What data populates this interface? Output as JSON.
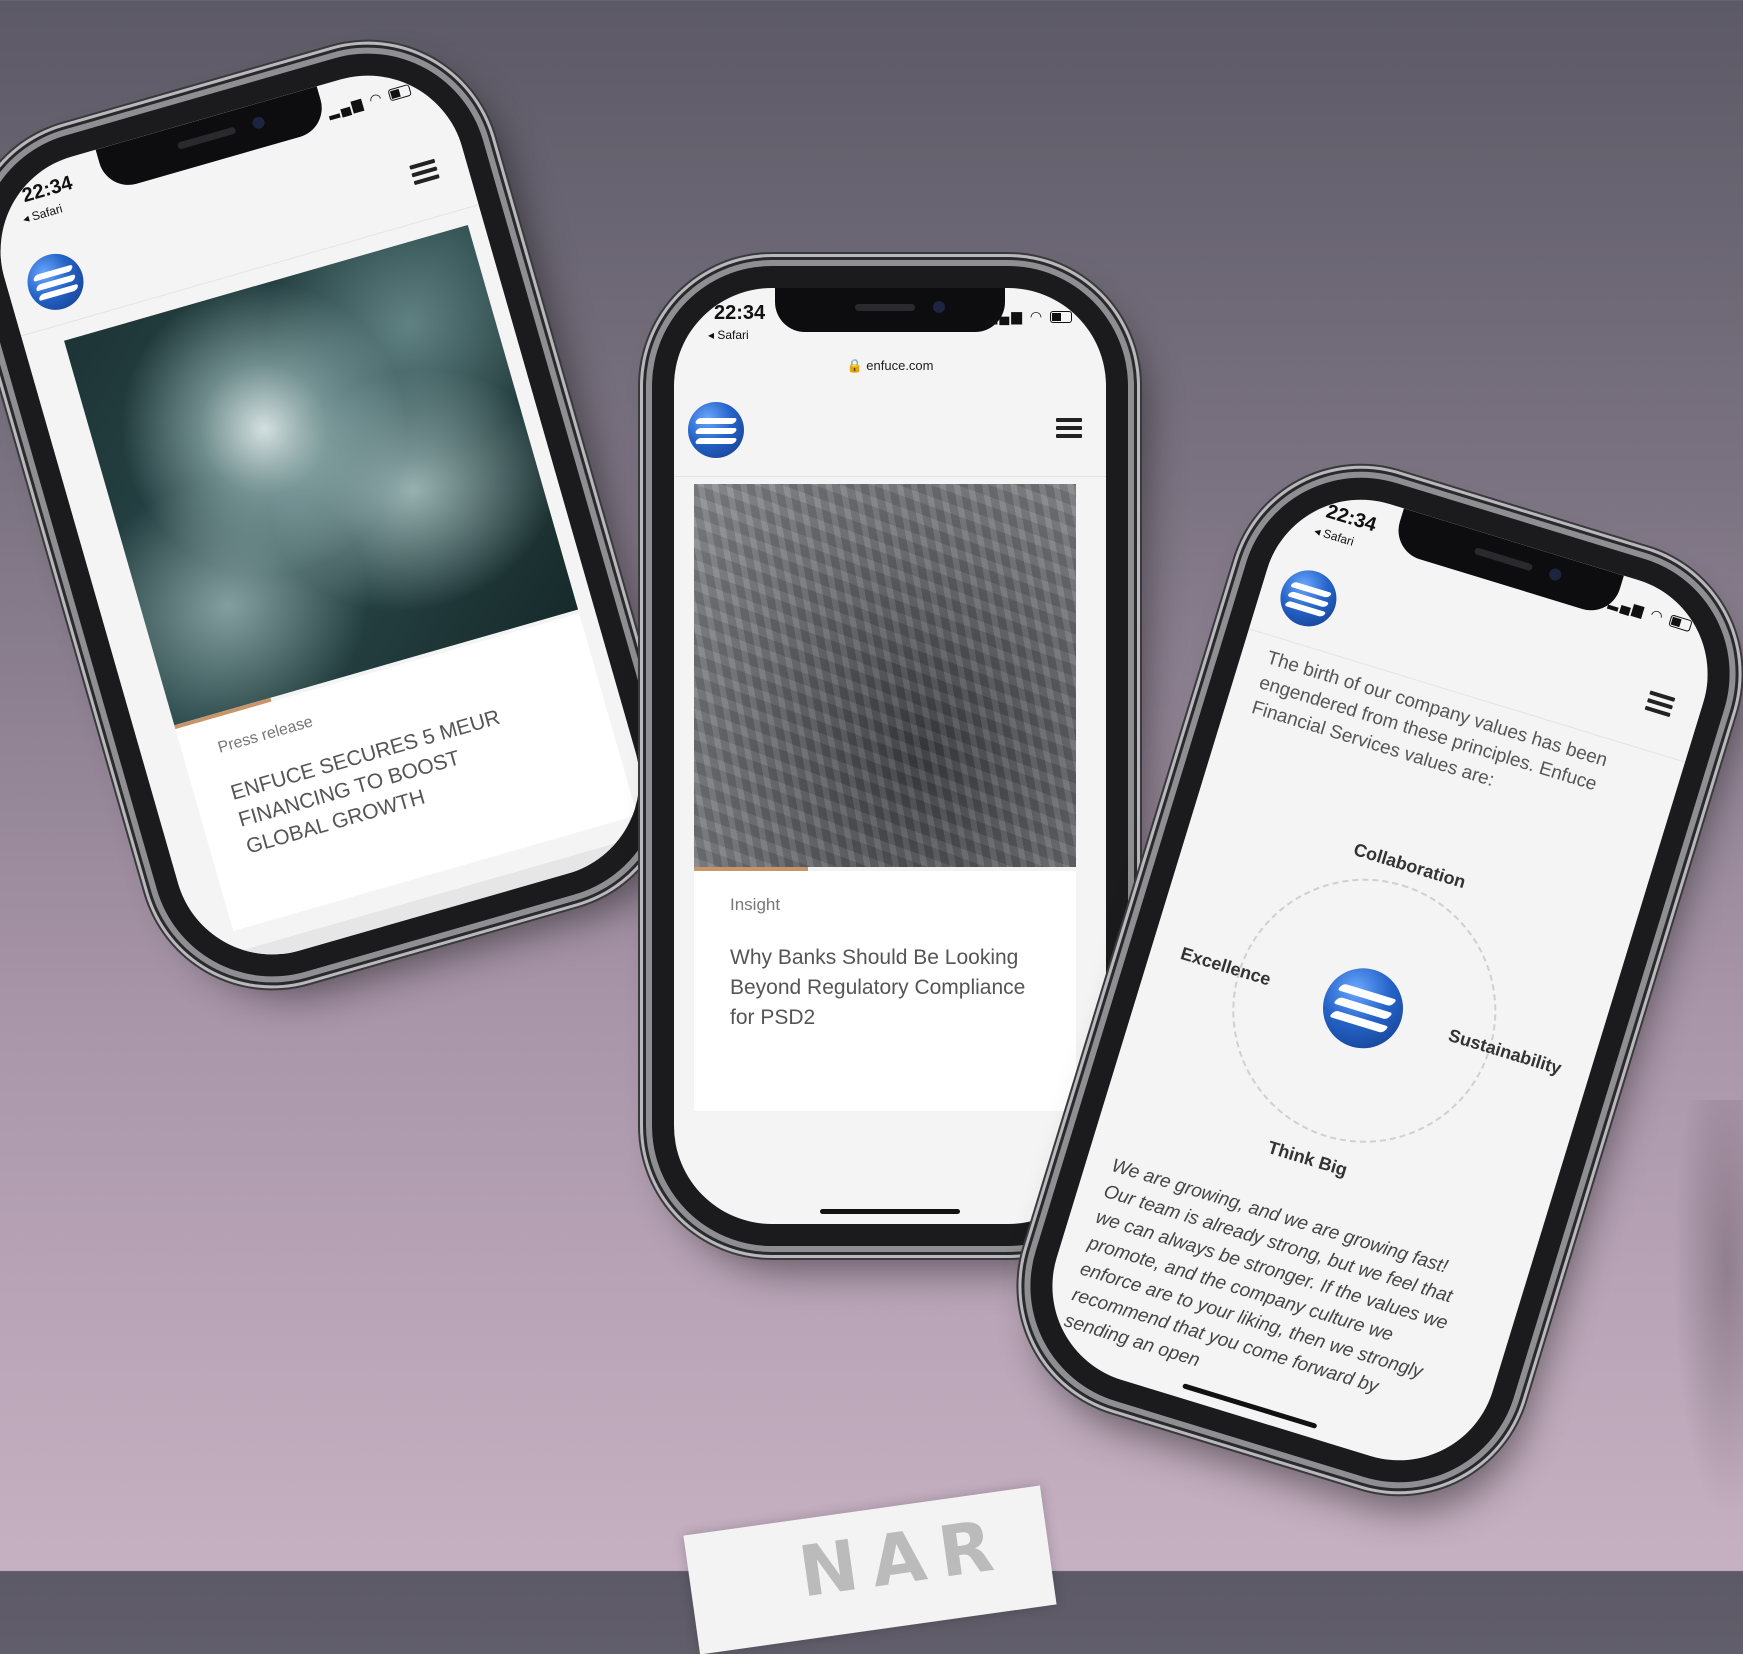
{
  "phones": [
    {
      "status": {
        "time": "22:34",
        "back": "◂ Safari"
      },
      "card": {
        "category": "Press release",
        "title": "ENFUCE SECURES 5 MEUR FINANCING TO BOOST GLOBAL GROWTH"
      }
    },
    {
      "status": {
        "time": "22:34",
        "back": "◂ Safari"
      },
      "url": "🔒 enfuce.com",
      "card": {
        "category": "Insight",
        "title": "Why Banks Should Be Looking Beyond Regulatory Compliance for PSD2"
      }
    },
    {
      "status": {
        "time": "22:34",
        "back": "◂ Safari"
      },
      "intro": "The birth of our company values has been engendered from these principles. Enfuce Financial Services values are:",
      "values": {
        "top": "Collaboration",
        "left": "Excellence",
        "right": "Sustainability",
        "bottom": "Think Big"
      },
      "body": "We are growing, and we are growing fast! Our team is already strong, but we feel that we can always be stronger. If the values we promote, and the company culture we enforce are to your liking, then we strongly recommend that you come forward by sending an open"
    }
  ],
  "icons": {
    "signal": "signal-icon",
    "wifi": "wifi-icon",
    "battery": "battery-icon",
    "menu": "hamburger-menu-icon",
    "logo": "enfuce-logo"
  },
  "colors": {
    "accent": "#c8956a",
    "brand_blue": "#2563c8"
  },
  "sticker_text": "NAR"
}
